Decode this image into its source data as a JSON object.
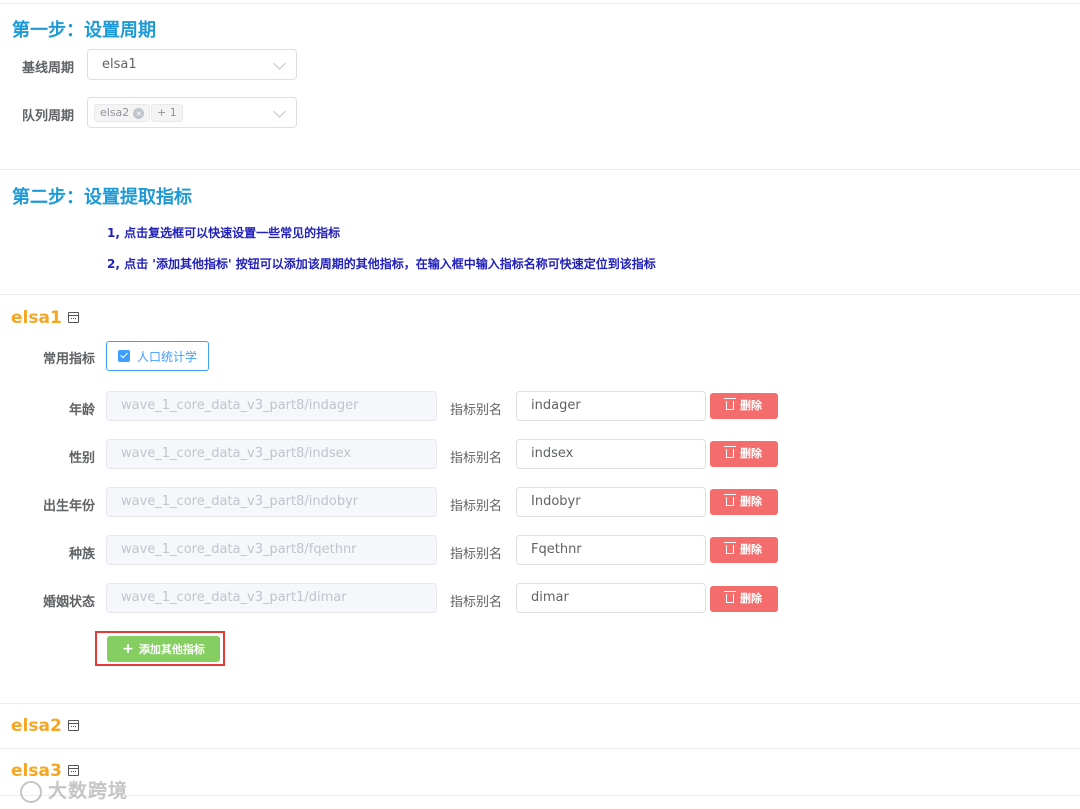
{
  "step1": {
    "title": "第一步：设置周期",
    "baseline_label": "基线周期",
    "baseline_value": "elsa1",
    "queue_label": "队列周期",
    "queue_tag": "elsa2",
    "queue_more": "+ 1"
  },
  "step2": {
    "title": "第二步：设置提取指标",
    "tip1": "1, 点击复选框可以快速设置一些常见的指标",
    "tip2": "2, 点击 '添加其他指标' 按钮可以添加该周期的其他指标，在输入框中输入指标名称可快速定位到该指标"
  },
  "periods": [
    {
      "name": "elsa1",
      "common_label": "常用指标",
      "checkbox_label": "人口统计学",
      "alias_label": "指标别名",
      "delete_label": "删除",
      "add_label": "添加其他指标",
      "rows": [
        {
          "label": "年龄",
          "path": "wave_1_core_data_v3_part8/indager",
          "alias": "indager"
        },
        {
          "label": "性别",
          "path": "wave_1_core_data_v3_part8/indsex",
          "alias": "indsex"
        },
        {
          "label": "出生年份",
          "path": "wave_1_core_data_v3_part8/indobyr",
          "alias": "Indobyr"
        },
        {
          "label": "种族",
          "path": "wave_1_core_data_v3_part8/fqethnr",
          "alias": "Fqethnr"
        },
        {
          "label": "婚姻状态",
          "path": "wave_1_core_data_v3_part1/dimar",
          "alias": "dimar"
        }
      ]
    },
    {
      "name": "elsa2"
    },
    {
      "name": "elsa3"
    }
  ],
  "watermark": "大数跨境",
  "icons": {
    "calendar": "calendar-icon",
    "chevron": "chevron-down-icon",
    "delete": "trash-icon",
    "add": "plus-icon",
    "check": "checkbox-checked-icon"
  },
  "colors": {
    "step_title": "#1e9bd7",
    "period_title": "#f5a623",
    "tip": "#2222bb",
    "danger": "#f56c6c",
    "success": "#85ce61",
    "primary": "#409eff"
  }
}
